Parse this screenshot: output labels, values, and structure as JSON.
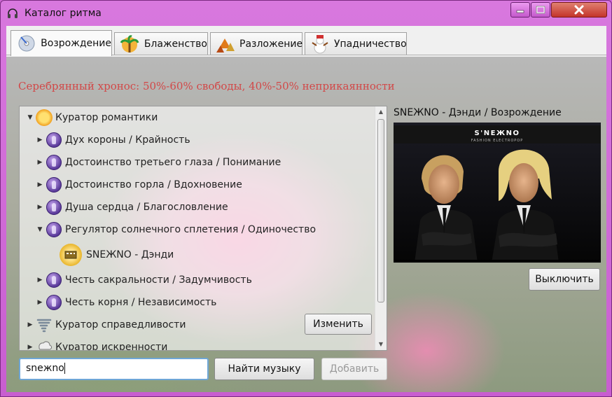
{
  "window": {
    "title": "Каталог ритма"
  },
  "tabs": [
    {
      "label": "Возрождение",
      "icon": "disc-icon",
      "active": true
    },
    {
      "label": "Блаженство",
      "icon": "palm-icon",
      "active": false
    },
    {
      "label": "Разложение",
      "icon": "autumn-leaves-icon",
      "active": false
    },
    {
      "label": "Упадничество",
      "icon": "snowman-icon",
      "active": false
    }
  ],
  "heading": "Серебрянный хронос: 50%-60% свободы, 40%-50% неприкаянности",
  "tree": {
    "items": [
      {
        "label": "Куратор романтики",
        "arrow": "▼",
        "icon": "sun-icon"
      },
      {
        "label": "Дух короны / Крайность",
        "arrow": "▶",
        "icon": "chakra-icon"
      },
      {
        "label": "Достоинство третьего глаза / Понимание",
        "arrow": "▶",
        "icon": "chakra-icon"
      },
      {
        "label": "Достоинство горла / Вдохновение",
        "arrow": "▶",
        "icon": "chakra-icon"
      },
      {
        "label": "Душа сердца / Благословление",
        "arrow": "▶",
        "icon": "chakra-icon"
      },
      {
        "label": "Регулятор солнечного сплетения / Одиночество",
        "arrow": "▼",
        "icon": "chakra-icon"
      },
      {
        "label": "SNEЖNO - Дэнди",
        "arrow": "",
        "icon": "film-icon"
      },
      {
        "label": "Честь сакральности / Задумчивость",
        "arrow": "▶",
        "icon": "chakra-icon"
      },
      {
        "label": "Честь корня / Независимость",
        "arrow": "▶",
        "icon": "chakra-icon"
      },
      {
        "label": "Куратор справедливости",
        "arrow": "▶",
        "icon": "tornado-icon"
      },
      {
        "label": "Куратор искренности",
        "arrow": "▶",
        "icon": "rain-cloud-icon"
      }
    ]
  },
  "buttons": {
    "change": "Изменить",
    "find": "Найти музыку",
    "add": "Добавить",
    "off": "Выключить"
  },
  "search": {
    "value": "snежno"
  },
  "player": {
    "title": "SNEЖNO - Дэнди / Возрождение",
    "cover_brand": "S'NEЖNO",
    "cover_sub": "FASHION ELECTROPOP"
  }
}
